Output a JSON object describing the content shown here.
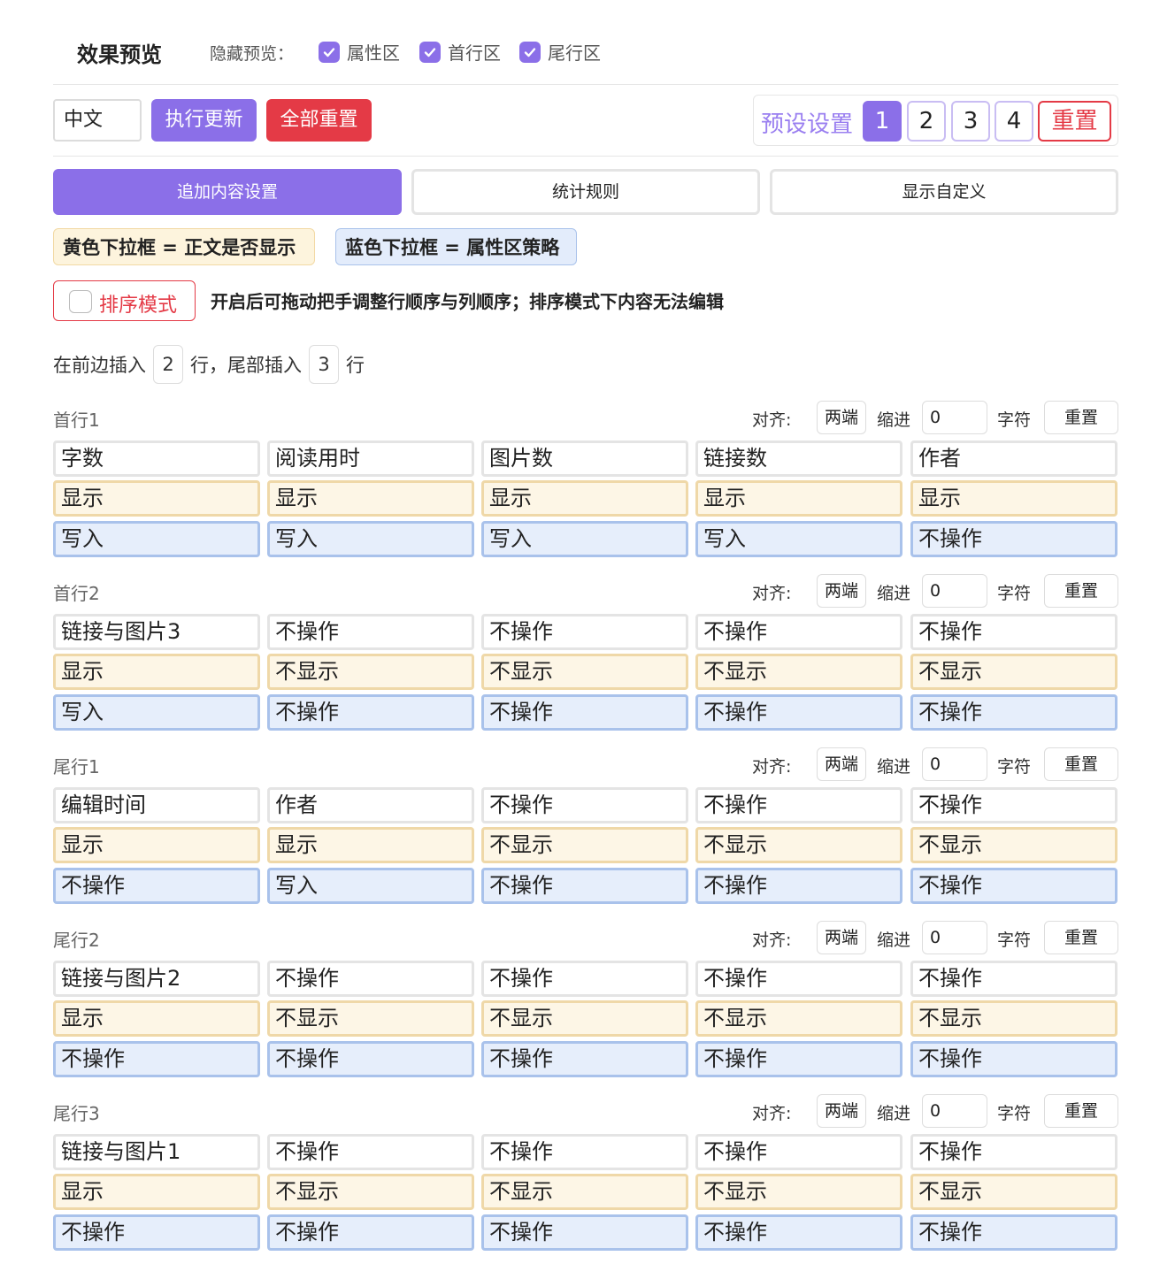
{
  "header": {
    "title": "效果预览",
    "hide_label": "隐藏预览：",
    "checkboxes": [
      {
        "label": "属性区",
        "checked": true
      },
      {
        "label": "首行区",
        "checked": true
      },
      {
        "label": "尾行区",
        "checked": true
      }
    ]
  },
  "toolbar": {
    "language_value": "中文",
    "update_label": "执行更新",
    "reset_all_label": "全部重置",
    "preset_label": "预设设置",
    "presets": [
      "1",
      "2",
      "3",
      "4"
    ],
    "active_preset": "1",
    "preset_reset_label": "重置"
  },
  "tabs": [
    {
      "label": "追加内容设置",
      "active": true
    },
    {
      "label": "统计规则",
      "active": false
    },
    {
      "label": "显示自定义",
      "active": false
    }
  ],
  "legend": {
    "yellow": "黄色下拉框 = 正文是否显示",
    "blue": "蓝色下拉框 = 属性区策略"
  },
  "sort": {
    "label": "排序模式",
    "checked": false,
    "description": "开启后可拖动把手调整行顺序与列顺序；排序模式下内容无法编辑"
  },
  "insert": {
    "prefix": "在前边插入",
    "front_count": "2",
    "middle": "行，尾部插入",
    "tail_count": "3",
    "suffix": "行"
  },
  "colors": {
    "accent": "#8b6fe8",
    "danger": "#e43a46",
    "yellow_bg": "#fdf6e6",
    "blue_bg": "#e6eefb"
  },
  "row_controls": {
    "align_label": "对齐:",
    "align_value": "两端",
    "indent_label": "缩进",
    "indent_value": "0",
    "unit_label": "字符",
    "reset_label": "重置"
  },
  "rows": [
    {
      "title": "首行1",
      "content": [
        "字数",
        "阅读用时",
        "图片数",
        "链接数",
        "作者"
      ],
      "display": [
        "显示",
        "显示",
        "显示",
        "显示",
        "显示"
      ],
      "strategy": [
        "写入",
        "写入",
        "写入",
        "写入",
        "不操作"
      ]
    },
    {
      "title": "首行2",
      "content": [
        "链接与图片3",
        "不操作",
        "不操作",
        "不操作",
        "不操作"
      ],
      "display": [
        "显示",
        "不显示",
        "不显示",
        "不显示",
        "不显示"
      ],
      "strategy": [
        "写入",
        "不操作",
        "不操作",
        "不操作",
        "不操作"
      ]
    },
    {
      "title": "尾行1",
      "content": [
        "编辑时间",
        "作者",
        "不操作",
        "不操作",
        "不操作"
      ],
      "display": [
        "显示",
        "显示",
        "不显示",
        "不显示",
        "不显示"
      ],
      "strategy": [
        "不操作",
        "写入",
        "不操作",
        "不操作",
        "不操作"
      ]
    },
    {
      "title": "尾行2",
      "content": [
        "链接与图片2",
        "不操作",
        "不操作",
        "不操作",
        "不操作"
      ],
      "display": [
        "显示",
        "不显示",
        "不显示",
        "不显示",
        "不显示"
      ],
      "strategy": [
        "不操作",
        "不操作",
        "不操作",
        "不操作",
        "不操作"
      ]
    },
    {
      "title": "尾行3",
      "content": [
        "链接与图片1",
        "不操作",
        "不操作",
        "不操作",
        "不操作"
      ],
      "display": [
        "显示",
        "不显示",
        "不显示",
        "不显示",
        "不显示"
      ],
      "strategy": [
        "不操作",
        "不操作",
        "不操作",
        "不操作",
        "不操作"
      ]
    }
  ]
}
